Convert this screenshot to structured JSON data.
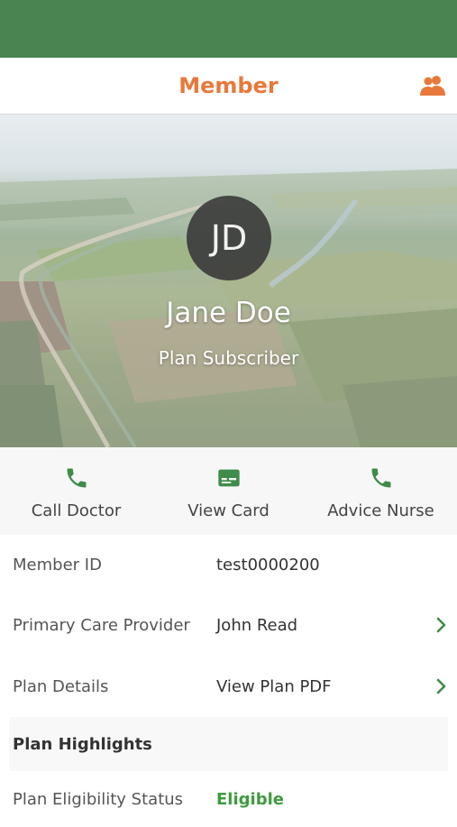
{
  "header": {
    "title": "Member",
    "icon": "people-icon",
    "accent_color": "#e8793a"
  },
  "status_bar": {
    "color": "#4a8450"
  },
  "profile": {
    "initials": "JD",
    "name": "Jane Doe",
    "role": "Plan Subscriber"
  },
  "actions": [
    {
      "label": "Call Doctor",
      "icon": "phone-icon"
    },
    {
      "label": "View Card",
      "icon": "card-icon"
    },
    {
      "label": "Advice Nurse",
      "icon": "phone-icon"
    }
  ],
  "details": {
    "member_id": {
      "label": "Member ID",
      "value": "test0000200"
    },
    "primary_care": {
      "label": "Primary Care Provider",
      "value": "John Read"
    },
    "plan_details": {
      "label": "Plan Details",
      "value": "View Plan PDF"
    },
    "plan_highlights": {
      "label": "Plan Highlights"
    },
    "eligibility": {
      "label": "Plan Eligibility Status",
      "value": "Eligible",
      "value_color": "#3f9b3f"
    }
  }
}
